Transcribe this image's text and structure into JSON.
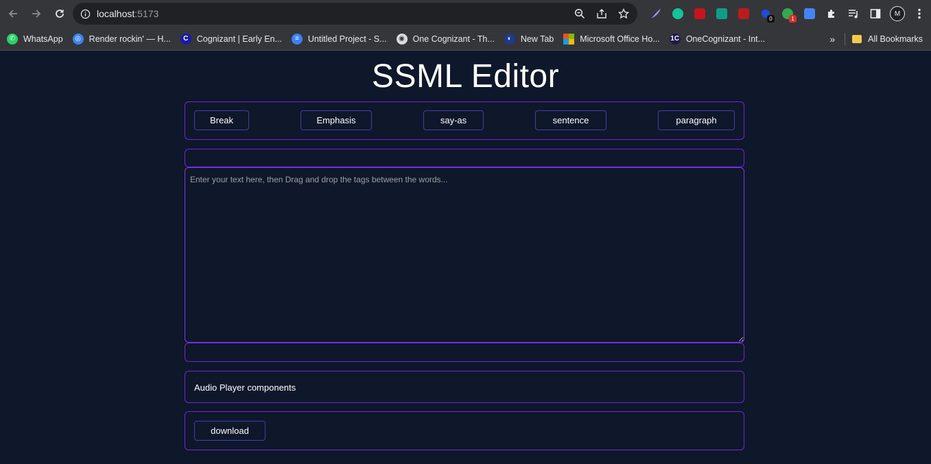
{
  "browser": {
    "url_host": "localhost",
    "url_port": ":5173",
    "bookmarks": [
      {
        "label": "WhatsApp",
        "color": "#25d366",
        "glyph": "✆"
      },
      {
        "label": "Render rockin' — H...",
        "color": "#3b82f6",
        "glyph": "◎"
      },
      {
        "label": "Cognizant | Early En...",
        "color": "#1a1aa8",
        "glyph": "C"
      },
      {
        "label": "Untitled Project - S...",
        "color": "#3b82f6",
        "glyph": "≡"
      },
      {
        "label": "One Cognizant - Th...",
        "color": "#dadce0",
        "glyph": "◉"
      },
      {
        "label": "New Tab",
        "color": "#1e3a8a",
        "glyph": "◐"
      },
      {
        "label": "Microsoft Office Ho...",
        "color": "ms",
        "glyph": ""
      },
      {
        "label": "OneCognizant - Int...",
        "color": "#1e1b4b",
        "glyph": "1C"
      }
    ],
    "all_bookmarks_label": "All Bookmarks",
    "profile_initial": "M",
    "extension_badges": {
      "first": "0",
      "second": "1"
    }
  },
  "page": {
    "title": "SSML Editor",
    "tags": [
      "Break",
      "Emphasis",
      "say-as",
      "sentence",
      "paragraph"
    ],
    "editor_placeholder": "Enter your text here, then Drag and drop the tags between the words...",
    "audio_label": "Audio Player components",
    "download_label": "download"
  },
  "colors": {
    "background": "#0f172a",
    "panel_border": "#6d28d9",
    "button_border": "#3f3fb0"
  }
}
